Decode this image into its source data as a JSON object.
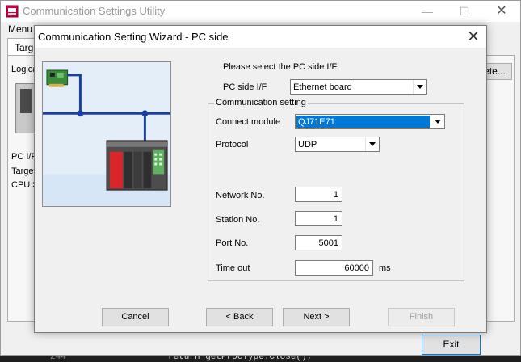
{
  "app": {
    "title": "Communication Settings Utility",
    "menu_label": "Menu",
    "tab_label": "Targe",
    "logical_label": "Logica",
    "delete_button_label": "ete...",
    "pc_if_label": "PC I/F",
    "target_label": "Target",
    "cpu_label": "CPU S",
    "exit_button_label": "Exit",
    "icon": "app-window-icon"
  },
  "code_strip": {
    "line_number": "244",
    "code_text": "return getProcType.Close();"
  },
  "dialog": {
    "title": "Communication Setting Wizard - PC side",
    "close_glyph": "✕",
    "illustration": "network-pc-to-plc-icon",
    "prompt": "Please select the PC side I/F",
    "pc_side_if": {
      "label": "PC side I/F",
      "value": "Ethernet board"
    },
    "group_title": "Communication setting",
    "connect_module": {
      "label": "Connect module",
      "value": "QJ71E71"
    },
    "protocol": {
      "label": "Protocol",
      "value": "UDP"
    },
    "network_no": {
      "label": "Network No.",
      "value": "1"
    },
    "station_no": {
      "label": "Station No.",
      "value": "1"
    },
    "port_no": {
      "label": "Port No.",
      "value": "5001"
    },
    "time_out": {
      "label": "Time out",
      "value": "60000",
      "unit": "ms"
    },
    "buttons": {
      "cancel": "Cancel",
      "back": "< Back",
      "next": "Next >",
      "finish": "Finish"
    }
  },
  "colors": {
    "selection": "#0078d7",
    "illustration_bg": "#e3eef9",
    "network_line": "#1a3fa0"
  }
}
